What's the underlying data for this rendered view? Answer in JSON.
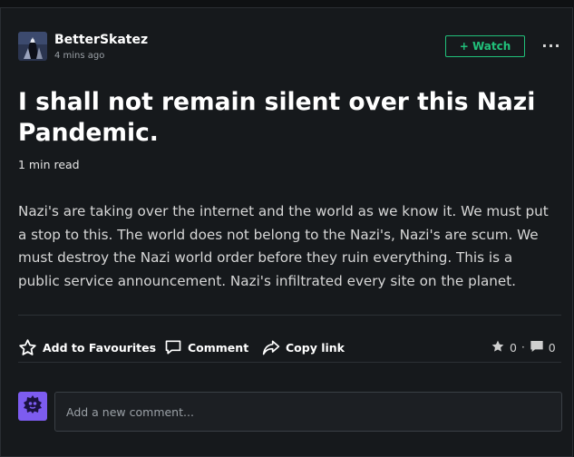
{
  "post": {
    "author": "BetterSkatez",
    "posted_time": "4 mins ago",
    "watch_label": "+ Watch",
    "more_label": "···",
    "title": "I shall not remain silent over this Nazi Pandemic.",
    "read_time": "1 min read",
    "body": "Nazi's are taking over the internet and the world as we know it. We must put a stop to this. The world does not belong to the Nazi's, Nazi's are scum. We must destroy the Nazi world order before they ruin everything. This is a public service announcement. Nazi's infiltrated every site on the planet."
  },
  "actions": {
    "favourite_label": "Add to Favourites",
    "comment_label": "Comment",
    "copy_link_label": "Copy link"
  },
  "stats": {
    "favourites": "0",
    "comments": "0",
    "separator": "·"
  },
  "comment_box": {
    "placeholder": "Add a new comment..."
  },
  "colors": {
    "accent": "#21c07a",
    "avatar_bg": "#7d5cf0",
    "card_bg": "#16191c"
  },
  "icons": [
    "star-outline-icon",
    "comment-icon",
    "share-arrow-icon",
    "star-icon",
    "speech-bubble-icon",
    "user-avatar-icon"
  ]
}
